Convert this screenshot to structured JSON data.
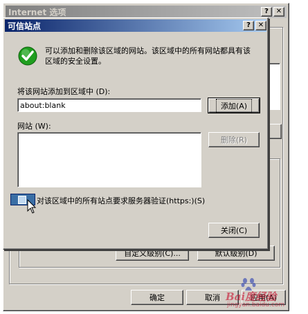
{
  "parent_window": {
    "title": "Internet 选项",
    "help_glyph": "?",
    "close_glyph": "✕",
    "buttons": {
      "ok": "确定",
      "cancel": "取消",
      "apply": "应用(A)"
    },
    "hidden_btn_left": "自定义级别(C)...",
    "hidden_btn_right": "默认级别(D)"
  },
  "dialog": {
    "title": "可信站点",
    "help_glyph": "?",
    "close_glyph": "✕",
    "info_icon": "check-icon",
    "info_text": "可以添加和删除该区域的网站。该区域中的所有网站都具有该区域的安全设置。",
    "add_label": "将该网站添加到区域中 (D):",
    "add_input_value": "about:blank",
    "add_button": "添加(A)",
    "sites_label": "网站 (W):",
    "sites_list": [],
    "remove_button": "删除(R)",
    "checkbox_label": "对该区域中的所有站点要求服务器验证(https:)(S)",
    "checkbox_checked": false,
    "close_button": "关闭(C)"
  },
  "watermark": {
    "text": "Bai度经验",
    "url": "jingyan.baidu.com"
  },
  "colors": {
    "face": "#d4d0c8",
    "active_title": "#0a246a",
    "inactive_title": "#808080",
    "check_green": "#1f9e1f"
  }
}
